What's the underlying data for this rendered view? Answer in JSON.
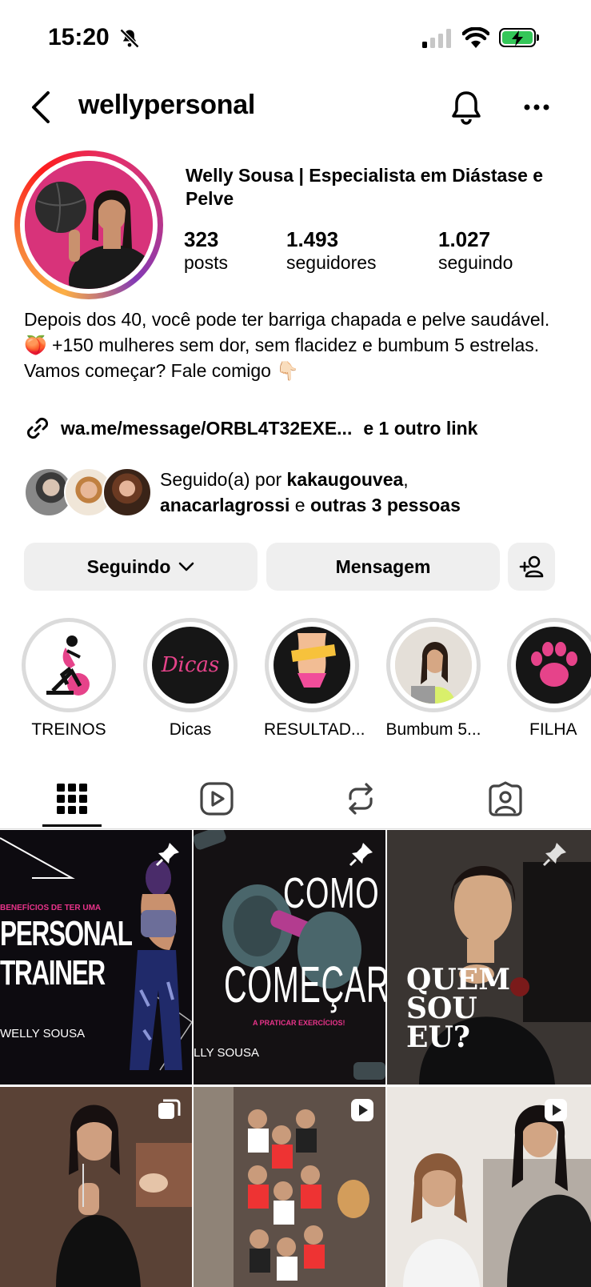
{
  "status_bar": {
    "time": "15:20"
  },
  "header": {
    "username": "wellypersonal"
  },
  "profile": {
    "full_name": "Welly  Sousa | Especialista em Diástase e Pelve",
    "stats": [
      {
        "value": "323",
        "label": "posts"
      },
      {
        "value": "1.493",
        "label": "seguidores"
      },
      {
        "value": "1.027",
        "label": "seguindo"
      }
    ],
    "bio_line1": "Depois dos 40, você pode ter barriga chapada e pelve saudável.",
    "bio_line2": "🍑 +150 mulheres sem dor, sem flacidez e bumbum 5 estrelas. Vamos começar? Fale comigo 👇🏻",
    "link": "wa.me/message/ORBL4T32EXE...",
    "link_extra": "e 1 outro link",
    "followed_prefix": "Seguido(a) por ",
    "followed_user1": "kakaugouvea",
    "followed_sep": ",",
    "followed_user2": "anacarlagrossi",
    "followed_mid": " e ",
    "followed_rest": "outras 3 pessoas"
  },
  "actions": {
    "following_label": "Seguindo",
    "message_label": "Mensagem"
  },
  "highlights": [
    {
      "label": "TREINOS"
    },
    {
      "label": "Dicas",
      "art_text": "Dicas"
    },
    {
      "label": "RESULTAD..."
    },
    {
      "label": "Bumbum 5..."
    },
    {
      "label": "FILHA"
    }
  ],
  "posts": [
    {
      "line1": "BENEFÍCIOS DE TER UMA",
      "line2": "PERSONAL",
      "line3": "TRAINER",
      "brand": "WELLY SOUSA"
    },
    {
      "line1": "COMO",
      "line2": "COMEÇAR",
      "sub": "A PRATICAR EXERCÍCIOS!",
      "brand": "LLY SOUSA"
    },
    {
      "line1": "QUEM",
      "line2": "SOU",
      "line3": "EU?"
    }
  ]
}
